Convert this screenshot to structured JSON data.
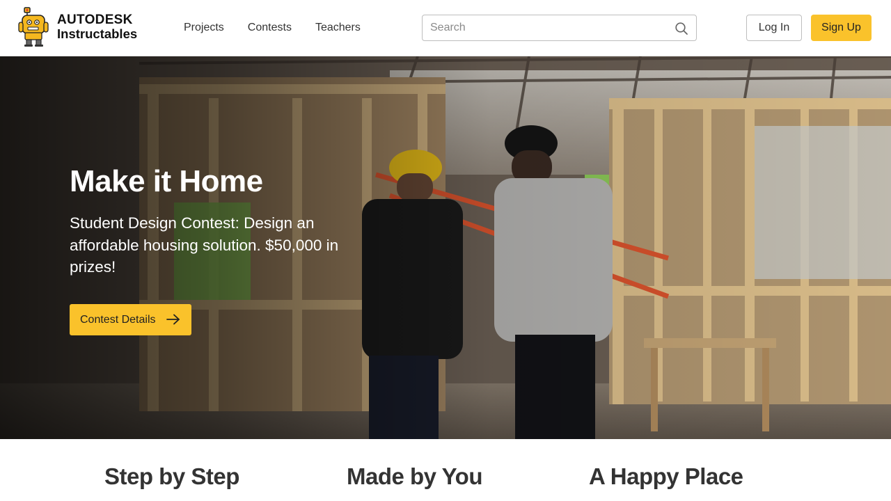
{
  "header": {
    "logo": {
      "brand": "AUTODESK",
      "product": "Instructables"
    },
    "nav": [
      {
        "label": "Projects"
      },
      {
        "label": "Contests"
      },
      {
        "label": "Teachers"
      }
    ],
    "search": {
      "placeholder": "Search",
      "value": ""
    },
    "login_label": "Log In",
    "signup_label": "Sign Up"
  },
  "hero": {
    "title": "Make it Home",
    "subtitle": "Student Design Contest: Design an affordable housing solution. $50,000 in prizes!",
    "cta_label": "Contest Details"
  },
  "features": [
    {
      "title": "Step by Step"
    },
    {
      "title": "Made by You"
    },
    {
      "title": "A Happy Place"
    }
  ],
  "colors": {
    "accent": "#fac22b",
    "text_dark": "#333333",
    "header_bg": "#ffffff"
  },
  "icons": {
    "logo": "robot-mascot-icon",
    "search": "search-icon",
    "cta": "arrow-right-icon"
  }
}
